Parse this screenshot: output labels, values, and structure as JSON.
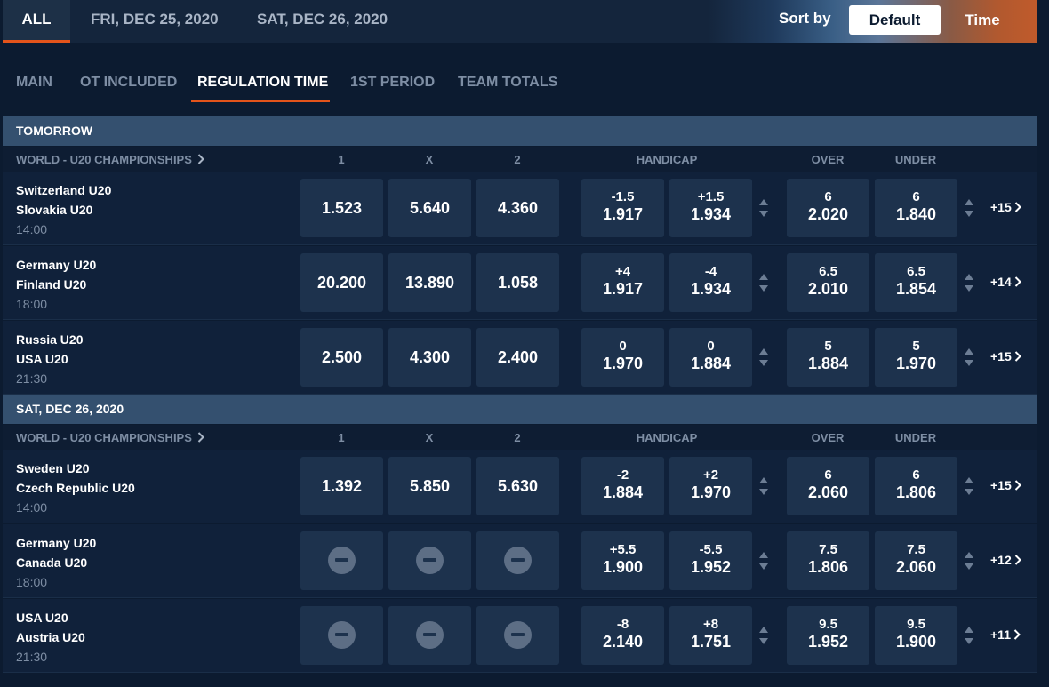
{
  "date_tabs": [
    {
      "label": "ALL",
      "active": true
    },
    {
      "label": "FRI, DEC 25, 2020",
      "active": false
    },
    {
      "label": "SAT, DEC 26, 2020",
      "active": false
    }
  ],
  "sort": {
    "label": "Sort by",
    "options": [
      "Default",
      "Time"
    ],
    "selected": "Default"
  },
  "market_tabs": [
    {
      "label": "MAIN",
      "active": false
    },
    {
      "label": "OT INCLUDED",
      "active": false
    },
    {
      "label": "REGULATION TIME",
      "active": true
    },
    {
      "label": "1ST PERIOD",
      "active": false
    },
    {
      "label": "TEAM TOTALS",
      "active": false
    }
  ],
  "columns": {
    "one": "1",
    "x": "X",
    "two": "2",
    "handicap": "HANDICAP",
    "over": "OVER",
    "under": "UNDER"
  },
  "sections": [
    {
      "title": "TOMORROW",
      "league": "WORLD - U20 CHAMPIONSHIPS",
      "events": [
        {
          "home": "Switzerland U20",
          "away": "Slovakia U20",
          "time": "14:00",
          "one": "1.523",
          "x": "5.640",
          "two": "4.360",
          "hcp1_line": "-1.5",
          "hcp1_price": "1.917",
          "hcp2_line": "+1.5",
          "hcp2_price": "1.934",
          "over_line": "6",
          "over_price": "2.020",
          "under_line": "6",
          "under_price": "1.840",
          "more": "+15"
        },
        {
          "home": "Germany U20",
          "away": "Finland U20",
          "time": "18:00",
          "one": "20.200",
          "x": "13.890",
          "two": "1.058",
          "hcp1_line": "+4",
          "hcp1_price": "1.917",
          "hcp2_line": "-4",
          "hcp2_price": "1.934",
          "over_line": "6.5",
          "over_price": "2.010",
          "under_line": "6.5",
          "under_price": "1.854",
          "more": "+14"
        },
        {
          "home": "Russia U20",
          "away": "USA U20",
          "time": "21:30",
          "one": "2.500",
          "x": "4.300",
          "two": "2.400",
          "hcp1_line": "0",
          "hcp1_price": "1.970",
          "hcp2_line": "0",
          "hcp2_price": "1.884",
          "over_line": "5",
          "over_price": "1.884",
          "under_line": "5",
          "under_price": "1.970",
          "more": "+15"
        }
      ]
    },
    {
      "title": "SAT, DEC 26, 2020",
      "league": "WORLD - U20 CHAMPIONSHIPS",
      "events": [
        {
          "home": "Sweden U20",
          "away": "Czech Republic U20",
          "time": "14:00",
          "one": "1.392",
          "x": "5.850",
          "two": "5.630",
          "hcp1_line": "-2",
          "hcp1_price": "1.884",
          "hcp2_line": "+2",
          "hcp2_price": "1.970",
          "over_line": "6",
          "over_price": "2.060",
          "under_line": "6",
          "under_price": "1.806",
          "more": "+15"
        },
        {
          "home": "Germany U20",
          "away": "Canada U20",
          "time": "18:00",
          "one": null,
          "x": null,
          "two": null,
          "hcp1_line": "+5.5",
          "hcp1_price": "1.900",
          "hcp2_line": "-5.5",
          "hcp2_price": "1.952",
          "over_line": "7.5",
          "over_price": "1.806",
          "under_line": "7.5",
          "under_price": "2.060",
          "more": "+12"
        },
        {
          "home": "USA U20",
          "away": "Austria U20",
          "time": "21:30",
          "one": null,
          "x": null,
          "two": null,
          "hcp1_line": "-8",
          "hcp1_price": "2.140",
          "hcp2_line": "+8",
          "hcp2_price": "1.751",
          "over_line": "9.5",
          "over_price": "1.952",
          "under_line": "9.5",
          "under_price": "1.900",
          "more": "+11"
        }
      ]
    }
  ],
  "colors": {
    "background": "#0c1b30",
    "accent": "#e4541b",
    "section_header": "#34506f",
    "odds_cell": "#1d324d"
  }
}
